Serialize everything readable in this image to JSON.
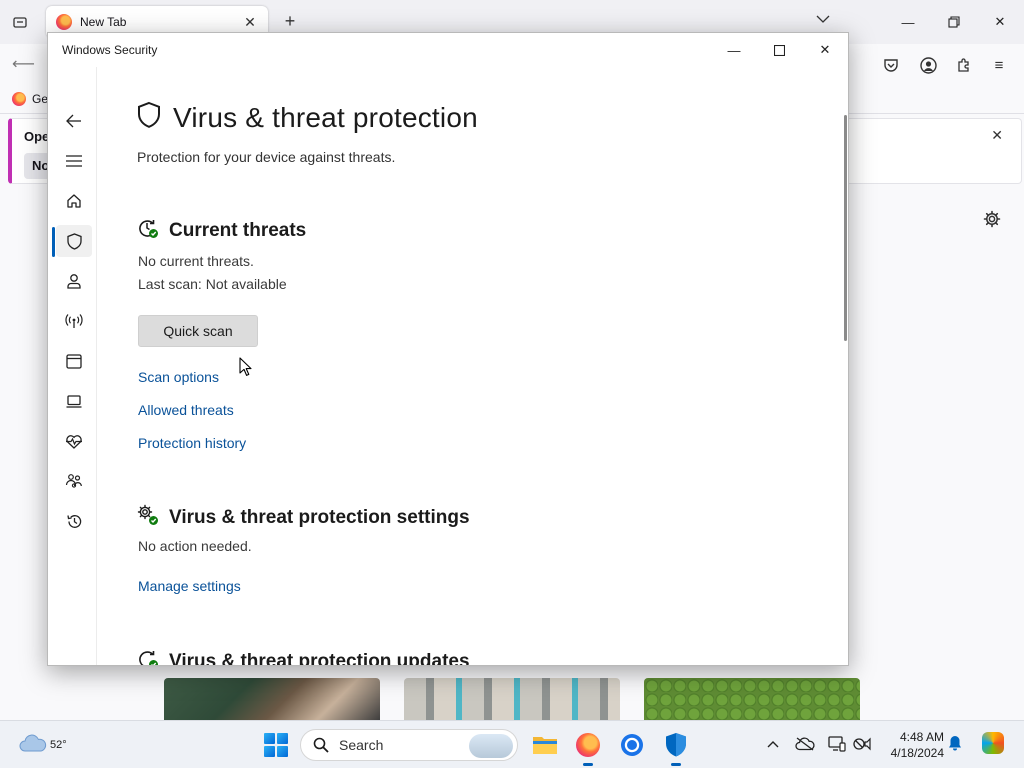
{
  "browser": {
    "tab_title": "New Tab",
    "bookmark_label": "Get",
    "notification_title": "Oper",
    "notification_button": "No"
  },
  "security_window": {
    "title": "Windows Security",
    "page_title": "Virus & threat protection",
    "page_subtitle": "Protection for your device against threats.",
    "current_threats": {
      "heading": "Current threats",
      "status": "No current threats.",
      "last_scan": "Last scan: Not available",
      "quick_scan_label": "Quick scan",
      "links": [
        "Scan options",
        "Allowed threats",
        "Protection history"
      ]
    },
    "settings_section": {
      "heading": "Virus & threat protection settings",
      "status": "No action needed.",
      "manage_link": "Manage settings"
    },
    "updates_section": {
      "heading": "Virus & threat protection updates"
    },
    "sidebar_icons": [
      "back-arrow-icon",
      "menu-icon",
      "home-icon",
      "shield-icon",
      "person-icon",
      "wireless-icon",
      "app-browser-icon",
      "laptop-icon",
      "heart-pulse-icon",
      "family-icon",
      "history-icon",
      "settings-gear-icon"
    ],
    "active_nav": "shield"
  },
  "taskbar": {
    "weather_temp": "52°",
    "search_placeholder": "Search",
    "time": "4:48 AM",
    "date": "4/18/2024"
  },
  "colors": {
    "accent": "#005fb8",
    "link": "#0a5299",
    "status_ok": "#107c10"
  }
}
